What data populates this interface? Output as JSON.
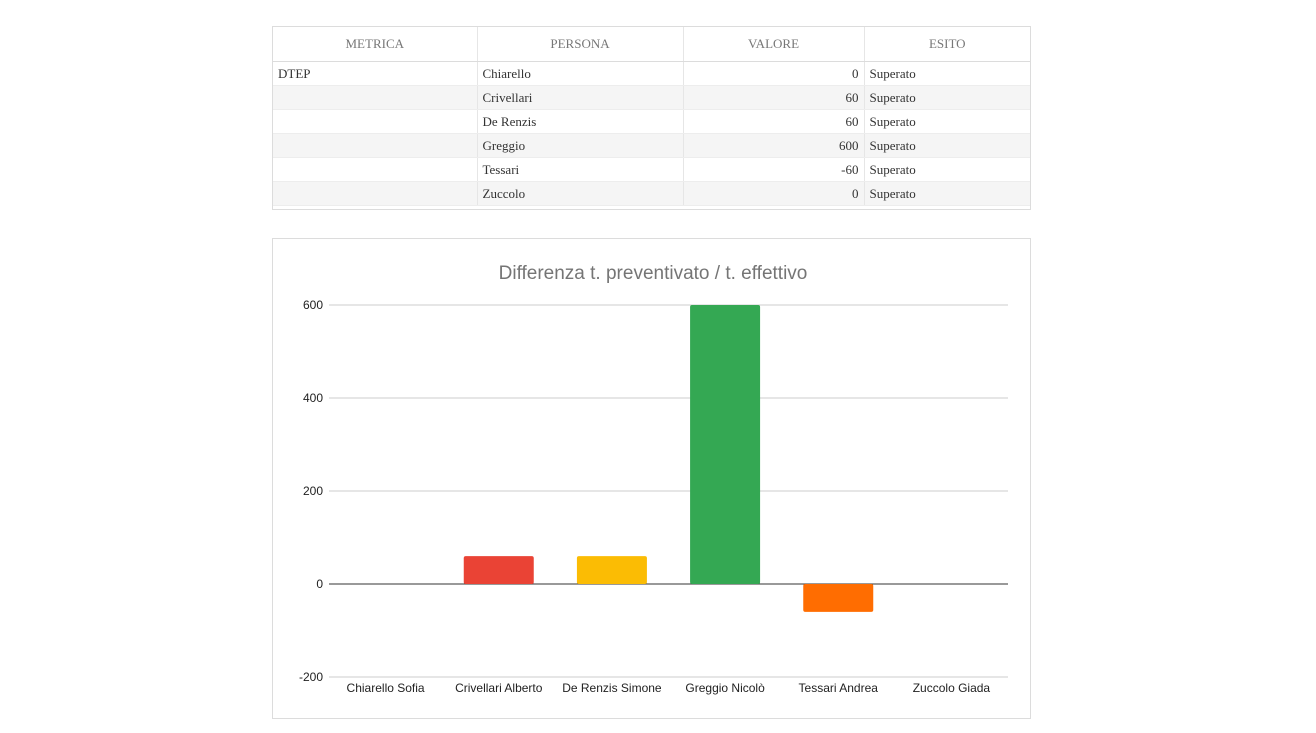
{
  "table": {
    "headers": [
      "METRICA",
      "PERSONA",
      "VALORE",
      "ESITO"
    ],
    "rows": [
      {
        "metrica": "DTEP",
        "persona": "Chiarello",
        "valore": "0",
        "esito": "Superato"
      },
      {
        "metrica": "",
        "persona": "Crivellari",
        "valore": "60",
        "esito": "Superato"
      },
      {
        "metrica": "",
        "persona": "De Renzis",
        "valore": "60",
        "esito": "Superato"
      },
      {
        "metrica": "",
        "persona": "Greggio",
        "valore": "600",
        "esito": "Superato"
      },
      {
        "metrica": "",
        "persona": "Tessari",
        "valore": "-60",
        "esito": "Superato"
      },
      {
        "metrica": "",
        "persona": "Zuccolo",
        "valore": "0",
        "esito": "Superato"
      }
    ]
  },
  "chart_data": {
    "type": "bar",
    "title": "Differenza t. preventivato / t. effettivo",
    "categories": [
      "Chiarello Sofia",
      "Crivellari Alberto",
      "De Renzis Simone",
      "Greggio Nicolò",
      "Tessari Andrea",
      "Zuccolo Giada"
    ],
    "values": [
      0,
      60,
      60,
      600,
      -60,
      0
    ],
    "colors": [
      "#4285f4",
      "#ea4335",
      "#fbbc04",
      "#34a853",
      "#ff6d01",
      "#46bdc6"
    ],
    "ylim": [
      -200,
      600
    ],
    "yticks": [
      600,
      400,
      200,
      0,
      -200
    ],
    "grid": true,
    "legend": "none"
  }
}
